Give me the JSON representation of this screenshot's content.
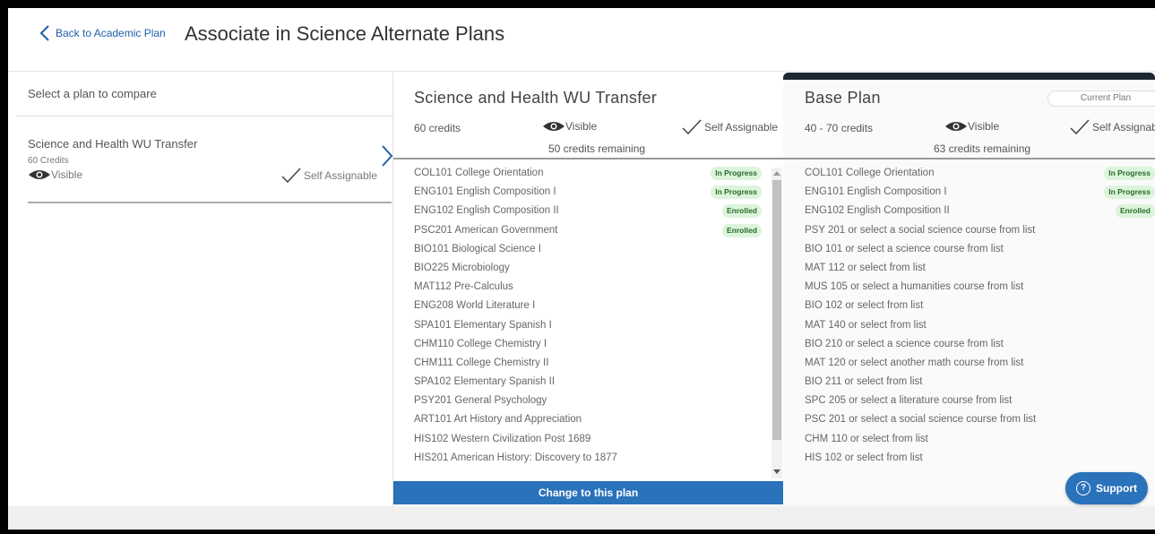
{
  "header": {
    "back_label": "Back to Academic Plan",
    "title": "Associate in Science Alternate Plans"
  },
  "left": {
    "heading": "Select a plan to compare",
    "card": {
      "name": "Science and Health WU Transfer",
      "credits": "60 Credits",
      "visible": "Visible",
      "self": "Self Assignable"
    }
  },
  "middle": {
    "title": "Science and Health WU Transfer",
    "credits": "60 credits",
    "visible": "Visible",
    "self": "Self Assignable",
    "remaining": "50 credits remaining",
    "courses": [
      {
        "name": "COL101 College Orientation",
        "badge": "In Progress"
      },
      {
        "name": "ENG101 English Composition I",
        "badge": "In Progress"
      },
      {
        "name": "ENG102 English Composition II",
        "badge": "Enrolled"
      },
      {
        "name": "PSC201 American Government",
        "badge": "Enrolled"
      },
      {
        "name": "BIO101 Biological Science I",
        "badge": ""
      },
      {
        "name": "BIO225 Microbiology",
        "badge": ""
      },
      {
        "name": "MAT112 Pre-Calculus",
        "badge": ""
      },
      {
        "name": "ENG208 World Literature I",
        "badge": ""
      },
      {
        "name": "SPA101 Elementary Spanish I",
        "badge": ""
      },
      {
        "name": "CHM110 College Chemistry I",
        "badge": ""
      },
      {
        "name": "CHM111 College Chemistry II",
        "badge": ""
      },
      {
        "name": "SPA102 Elementary Spanish II",
        "badge": ""
      },
      {
        "name": "PSY201 General Psychology",
        "badge": ""
      },
      {
        "name": "ART101 Art History and Appreciation",
        "badge": ""
      },
      {
        "name": "HIS102 Western Civilization Post 1689",
        "badge": ""
      },
      {
        "name": "HIS201 American History: Discovery to 1877",
        "badge": ""
      }
    ],
    "change_button": "Change to this plan"
  },
  "right": {
    "title": "Base Plan",
    "current_plan": "Current Plan",
    "credits": "40 - 70 credits",
    "visible": "Visible",
    "self": "Self Assignab",
    "remaining": "63 credits remaining",
    "courses": [
      {
        "name": "COL101 College Orientation",
        "badge": "In Progress"
      },
      {
        "name": "ENG101 English Composition I",
        "badge": "In Progress"
      },
      {
        "name": "ENG102 English Composition II",
        "badge": "Enrolled"
      },
      {
        "name": "PSY 201 or select a social science course from list",
        "badge": ""
      },
      {
        "name": "BIO 101 or select a science course from list",
        "badge": ""
      },
      {
        "name": "MAT 112 or select from list",
        "badge": ""
      },
      {
        "name": "MUS 105 or select a humanities course from list",
        "badge": ""
      },
      {
        "name": "BIO 102 or select from list",
        "badge": ""
      },
      {
        "name": "MAT 140 or select from list",
        "badge": ""
      },
      {
        "name": "BIO 210 or select a science course from list",
        "badge": ""
      },
      {
        "name": "MAT 120 or select another math course from list",
        "badge": ""
      },
      {
        "name": "BIO 211 or select from list",
        "badge": ""
      },
      {
        "name": "SPC 205 or select a literature course from list",
        "badge": ""
      },
      {
        "name": "PSC 201 or select a social science course from list",
        "badge": ""
      },
      {
        "name": "CHM 110 or select from list",
        "badge": ""
      },
      {
        "name": "HIS 102 or select from list",
        "badge": ""
      }
    ]
  },
  "support": {
    "label": "Support",
    "icon": "question-circle-icon"
  },
  "colors": {
    "accent": "#2a72ba",
    "link": "#1f5fa8",
    "badge_bg": "#dcf4dc",
    "badge_text": "#2a6b2a",
    "topbar": "#1c2733"
  }
}
